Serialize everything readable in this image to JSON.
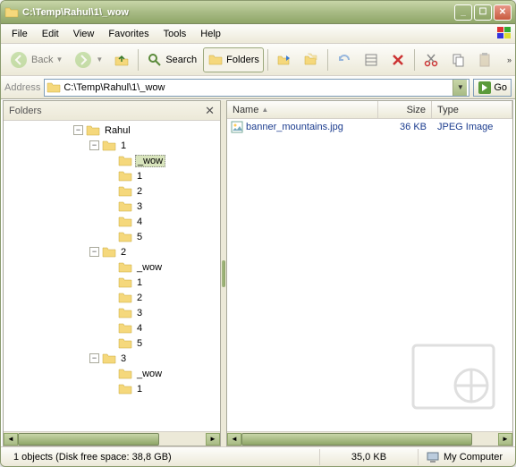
{
  "title": "C:\\Temp\\Rahul\\1\\_wow",
  "menu": [
    "File",
    "Edit",
    "View",
    "Favorites",
    "Tools",
    "Help"
  ],
  "toolbar": {
    "back": "Back",
    "search": "Search",
    "folders": "Folders"
  },
  "address": {
    "label": "Address",
    "path": "C:\\Temp\\Rahul\\1\\_wow",
    "go": "Go"
  },
  "folders_pane": {
    "title": "Folders"
  },
  "tree": [
    {
      "depth": 0,
      "exp": "-",
      "label": "Rahul"
    },
    {
      "depth": 1,
      "exp": "-",
      "label": "1"
    },
    {
      "depth": 2,
      "exp": "",
      "label": "_wow",
      "selected": true
    },
    {
      "depth": 2,
      "exp": "",
      "label": "1"
    },
    {
      "depth": 2,
      "exp": "",
      "label": "2"
    },
    {
      "depth": 2,
      "exp": "",
      "label": "3"
    },
    {
      "depth": 2,
      "exp": "",
      "label": "4"
    },
    {
      "depth": 2,
      "exp": "",
      "label": "5"
    },
    {
      "depth": 1,
      "exp": "-",
      "label": "2"
    },
    {
      "depth": 2,
      "exp": "",
      "label": "_wow"
    },
    {
      "depth": 2,
      "exp": "",
      "label": "1"
    },
    {
      "depth": 2,
      "exp": "",
      "label": "2"
    },
    {
      "depth": 2,
      "exp": "",
      "label": "3"
    },
    {
      "depth": 2,
      "exp": "",
      "label": "4"
    },
    {
      "depth": 2,
      "exp": "",
      "label": "5"
    },
    {
      "depth": 1,
      "exp": "-",
      "label": "3"
    },
    {
      "depth": 2,
      "exp": "",
      "label": "_wow"
    },
    {
      "depth": 2,
      "exp": "",
      "label": "1"
    }
  ],
  "columns": {
    "name": "Name",
    "size": "Size",
    "type": "Type"
  },
  "files": [
    {
      "name": "banner_mountains.jpg",
      "size": "36 KB",
      "type": "JPEG Image"
    }
  ],
  "status": {
    "objects": "1 objects (Disk free space: 38,8 GB)",
    "size": "35,0 KB",
    "location": "My Computer"
  }
}
